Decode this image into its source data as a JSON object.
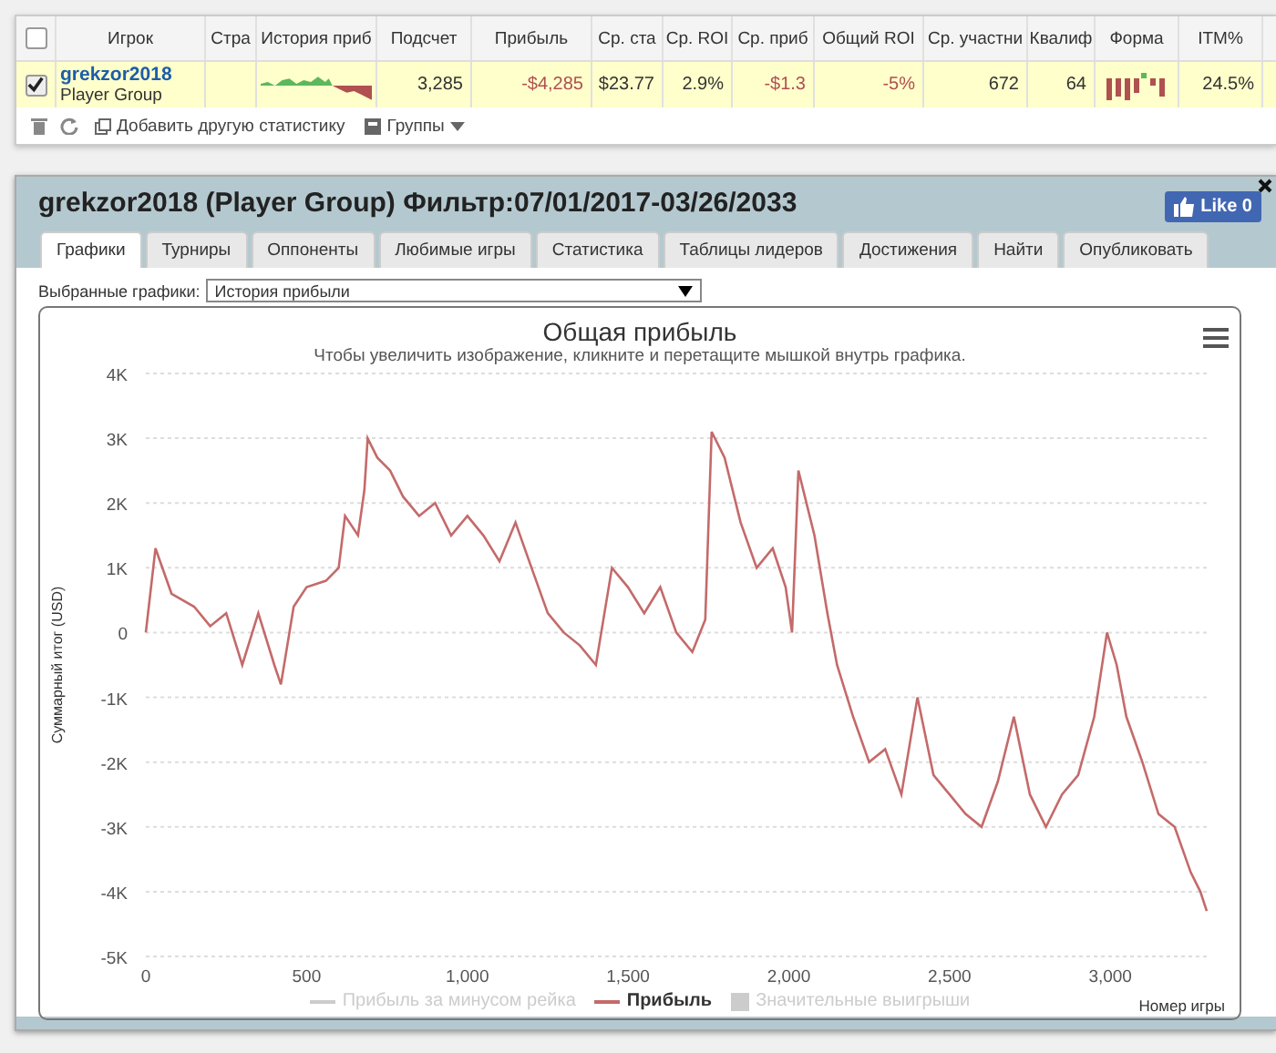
{
  "table": {
    "select_all": false,
    "columns": [
      {
        "kind": "check"
      },
      {
        "label": "Игрок",
        "kind": "player"
      },
      {
        "label": "Стра",
        "kind": "blank"
      },
      {
        "label": "История приб",
        "kind": "sparkline"
      },
      {
        "label": "Подсчет",
        "kind": "value"
      },
      {
        "label": "Прибыль",
        "kind": "value"
      },
      {
        "label": "Ср. ста",
        "kind": "value"
      },
      {
        "label": "Ср. ROI",
        "kind": "value"
      },
      {
        "label": "Ср. приб",
        "kind": "value"
      },
      {
        "label": "Общий ROI",
        "kind": "value"
      },
      {
        "label": "Ср. участни",
        "kind": "value"
      },
      {
        "label": "Квалиф",
        "kind": "value"
      },
      {
        "label": "Форма",
        "kind": "form"
      },
      {
        "label": "ITM%",
        "kind": "value"
      }
    ],
    "rows": [
      {
        "checked": true,
        "player": "grekzor2018",
        "group": "Player Group",
        "values": [
          {
            "text": "3,285",
            "negative": false
          },
          {
            "text": "-$4,285",
            "negative": true
          },
          {
            "text": "$23.77",
            "negative": false
          },
          {
            "text": "2.9%",
            "negative": false
          },
          {
            "text": "-$1.3",
            "negative": true
          },
          {
            "text": "-5%",
            "negative": true
          },
          {
            "text": "672",
            "negative": false
          },
          {
            "text": "64",
            "negative": false
          },
          {
            "text": "24.5%",
            "negative": false
          }
        ]
      }
    ]
  },
  "toolbar": {
    "add_stats": "Добавить другую статистику",
    "groups": "Группы"
  },
  "panel": {
    "title": "grekzor2018 (Player Group) Фильтр:07/01/2017-03/26/2033",
    "like": "Like 0",
    "tabs": [
      {
        "label": "Графики",
        "selected": true
      },
      {
        "label": "Турниры",
        "selected": false
      },
      {
        "label": "Оппоненты",
        "selected": false
      },
      {
        "label": "Любимые игры",
        "selected": false
      },
      {
        "label": "Статистика",
        "selected": false
      },
      {
        "label": "Таблицы лидеров",
        "selected": false
      },
      {
        "label": "Достижения",
        "selected": false
      },
      {
        "label": "Найти",
        "selected": false
      },
      {
        "label": "Опубликовать",
        "selected": false
      }
    ],
    "chart_select": {
      "label": "Выбранные графики:",
      "value": "История прибыли"
    },
    "chart": {
      "subtitle": "Чтобы увеличить изображение, кликните и перетащите мышкой внутрь графика.",
      "legend": [
        {
          "label": "Прибыль за минусом рейка",
          "kind": "line",
          "visible": false
        },
        {
          "kind": "series",
          "visible": true
        },
        {
          "label": "Значительные выигрыши",
          "kind": "box",
          "visible": false
        }
      ],
      "chart_data": {
        "type": "line",
        "title": "Общая прибыль",
        "xlabel": "Номер игры",
        "ylabel": "Суммарный итог (USD)",
        "x": [
          0,
          30,
          80,
          150,
          200,
          250,
          300,
          350,
          400,
          420,
          460,
          500,
          560,
          600,
          620,
          660,
          680,
          690,
          720,
          760,
          800,
          850,
          900,
          950,
          1000,
          1050,
          1100,
          1150,
          1200,
          1250,
          1300,
          1350,
          1400,
          1450,
          1500,
          1550,
          1600,
          1650,
          1700,
          1740,
          1760,
          1800,
          1850,
          1900,
          1950,
          1990,
          2010,
          2030,
          2080,
          2120,
          2150,
          2200,
          2250,
          2300,
          2350,
          2400,
          2450,
          2500,
          2550,
          2600,
          2650,
          2700,
          2750,
          2800,
          2850,
          2900,
          2950,
          2990,
          3020,
          3050,
          3100,
          3150,
          3200,
          3250,
          3280,
          3300
        ],
        "series": [
          {
            "name": "Прибыль",
            "color": "#c46a6a",
            "values": [
              0,
              1300,
              600,
              400,
              100,
              300,
              -500,
              300,
              -500,
              -800,
              400,
              700,
              800,
              1000,
              1800,
              1500,
              2200,
              3000,
              2700,
              2500,
              2100,
              1800,
              2000,
              1500,
              1800,
              1500,
              1100,
              1700,
              1000,
              300,
              0,
              -200,
              -500,
              1000,
              700,
              300,
              700,
              0,
              -300,
              200,
              3100,
              2700,
              1700,
              1000,
              1300,
              700,
              0,
              2500,
              1500,
              300,
              -500,
              -1300,
              -2000,
              -1800,
              -2500,
              -1000,
              -2200,
              -2500,
              -2800,
              -3000,
              -2300,
              -1300,
              -2500,
              -3000,
              -2500,
              -2200,
              -1300,
              0,
              -500,
              -1300,
              -2000,
              -2800,
              -3000,
              -3700,
              -4000,
              -4300
            ]
          }
        ],
        "grid": true,
        "xlim": [
          0,
          3300
        ],
        "ylim": [
          -5000,
          4000
        ],
        "xticks": [
          {
            "value": 0,
            "label": "0"
          },
          {
            "value": 500,
            "label": "500"
          },
          {
            "value": 1000,
            "label": "1,000"
          },
          {
            "value": 1500,
            "label": "1,500"
          },
          {
            "value": 2000,
            "label": "2,000"
          },
          {
            "value": 2500,
            "label": "2,500"
          },
          {
            "value": 3000,
            "label": "3,000"
          }
        ],
        "yticks": [
          {
            "value": 4000,
            "label": "4K"
          },
          {
            "value": 3000,
            "label": "3K"
          },
          {
            "value": 2000,
            "label": "2K"
          },
          {
            "value": 1000,
            "label": "1K"
          },
          {
            "value": 0,
            "label": "0"
          },
          {
            "value": -1000,
            "label": "-1K"
          },
          {
            "value": -2000,
            "label": "-2K"
          },
          {
            "value": -3000,
            "label": "-3K"
          },
          {
            "value": -4000,
            "label": "-4K"
          },
          {
            "value": -5000,
            "label": "-5K"
          }
        ]
      }
    }
  }
}
